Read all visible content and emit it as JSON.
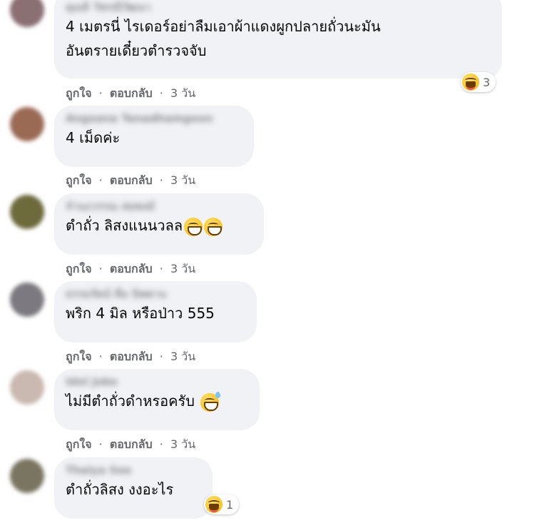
{
  "actions": {
    "like": "ถูกใจ",
    "reply": "ตอบกลับ",
    "separator": "·"
  },
  "comments": [
    {
      "name": "คุณธิ วัชรณีวัฒนา",
      "line1": "4 เมตรนี่ ไรเดอร์อย่าลืมเอาผ้าแดงผูกปลายถั่วนะมัน",
      "line2": "อันตรายเดี๋ยวตำรวจจับ",
      "time": "3 วัน",
      "reaction_count": "3",
      "avatar_color": "#8a6f73"
    },
    {
      "name": "Angsana Tanadhamgoon",
      "line1": "4 เม็ดค่ะ",
      "time": "3 วัน",
      "avatar_color": "#9a6a55"
    },
    {
      "name": "จำนงวรรณ สมพงษ์",
      "line1": "ตำถั่ว ลิสงแนนวลล",
      "time": "3 วัน",
      "avatar_color": "#6d6a3c"
    },
    {
      "name": "ธรรมรัตน์ คือ นิพพาน",
      "line1": "พริก 4 มิล หรือป่าว 555",
      "time": "3 วัน",
      "avatar_color": "#7c7a80"
    },
    {
      "name": "Idol Joke",
      "line1": "ไม่มีตำถั่วดำหรอครับ",
      "time": "3 วัน",
      "avatar_color": "#c9b9b0"
    },
    {
      "name": "Thaiya See",
      "line1": "ตำถั่วลิสง งงอะไร",
      "reaction_count": "1",
      "avatar_color": "#7a7560"
    }
  ],
  "colors": {
    "bubble": "#f0f2f5",
    "meta_text": "#65676b",
    "body_text": "#050505",
    "emoji_yellow": "#f5b301"
  },
  "icons": {
    "reaction": "laughing-face-icon",
    "inline_emoji_grin": "grinning-face-icon",
    "inline_emoji_sweat": "grinning-sweat-face-icon"
  }
}
